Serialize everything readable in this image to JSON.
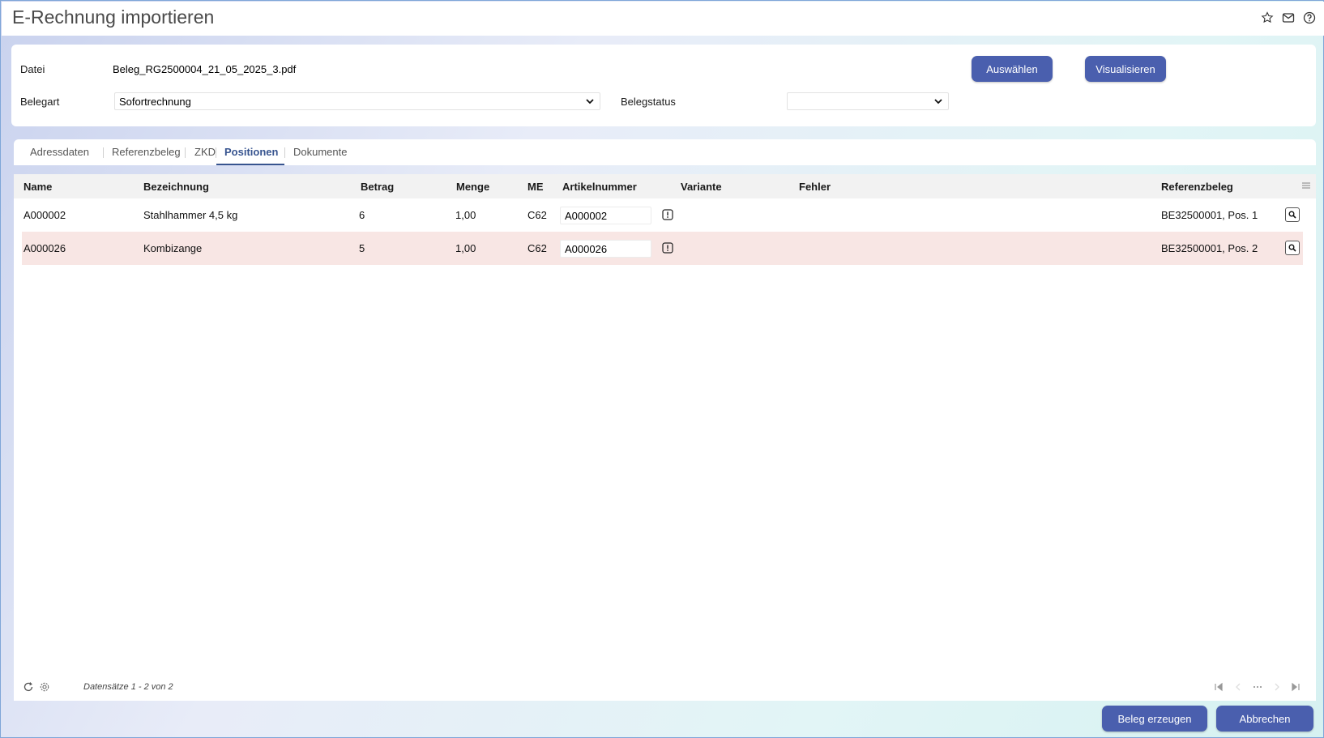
{
  "window": {
    "title": "E-Rechnung importieren"
  },
  "header_icons": [
    "star-icon",
    "mail-icon",
    "help-icon"
  ],
  "form": {
    "datei_label": "Datei",
    "datei_value": "Beleg_RG2500004_21_05_2025_3.pdf",
    "belegart_label": "Belegart",
    "belegart_value": "Sofortrechnung",
    "belegstatus_label": "Belegstatus",
    "belegstatus_value": "",
    "select_button": "Auswählen",
    "visualize_button": "Visualisieren"
  },
  "tabs": [
    {
      "label": "Adressdaten"
    },
    {
      "label": "Referenzbeleg"
    },
    {
      "label": "ZKD"
    },
    {
      "label": "Positionen",
      "active": true
    },
    {
      "label": "Dokumente"
    }
  ],
  "grid": {
    "columns": [
      "Name",
      "Bezeichnung",
      "Betrag",
      "Menge",
      "ME",
      "Artikelnummer",
      "Variante",
      "Fehler",
      "Referenzbeleg"
    ],
    "rows": [
      {
        "name": "A000002",
        "bezeichnung": "Stahlhammer 4,5 kg",
        "betrag": "6",
        "menge": "1,00",
        "me": "C62",
        "artikelnummer": "A000002",
        "variante": "",
        "fehler": "",
        "referenzbeleg": "BE32500001, Pos. 1"
      },
      {
        "name": "A000026",
        "bezeichnung": "Kombizange",
        "betrag": "5",
        "menge": "1,00",
        "me": "C62",
        "artikelnummer": "A000026",
        "variante": "",
        "fehler": "",
        "referenzbeleg": "BE32500001, Pos. 2"
      }
    ],
    "records_text": "Datensätze 1 - 2 von 2"
  },
  "actions": {
    "create_button": "Beleg erzeugen",
    "cancel_button": "Abbrechen"
  },
  "colors": {
    "primary": "#4a5fae",
    "active_tab": "#37548f",
    "highlight_row": "#f8e6e4"
  }
}
